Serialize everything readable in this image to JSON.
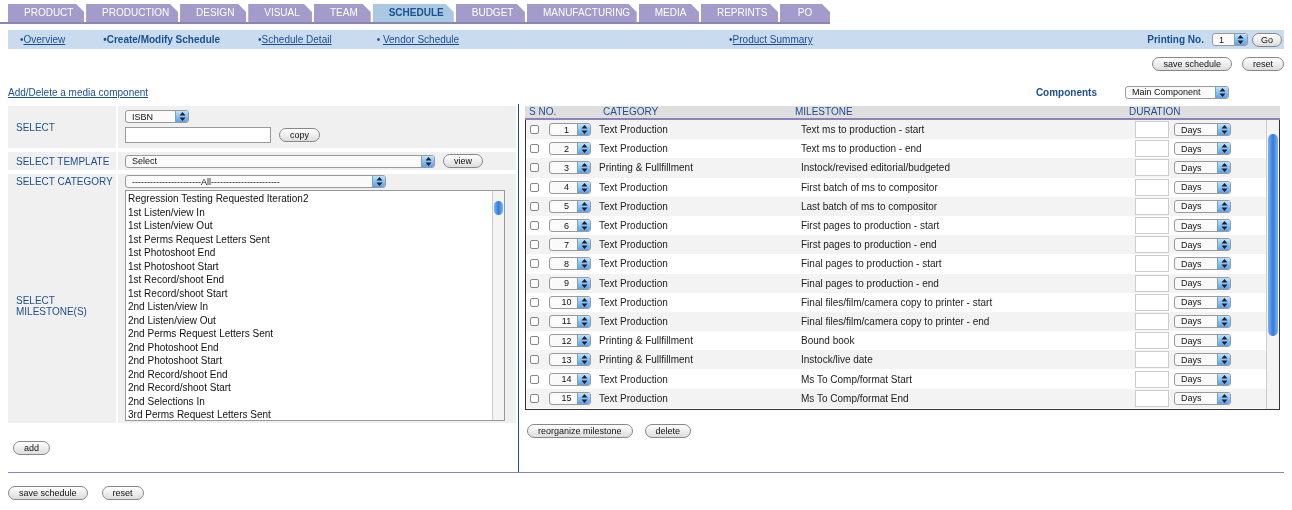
{
  "tabs": [
    {
      "label": "PRODUCT",
      "selected": false
    },
    {
      "label": "PRODUCTION",
      "selected": false
    },
    {
      "label": "DESIGN",
      "selected": false
    },
    {
      "label": "VISUAL",
      "selected": false
    },
    {
      "label": "TEAM",
      "selected": false
    },
    {
      "label": "SCHEDULE",
      "selected": true
    },
    {
      "label": "BUDGET",
      "selected": false
    },
    {
      "label": "MANUFACTURING",
      "selected": false
    },
    {
      "label": "MEDIA",
      "selected": false
    },
    {
      "label": "REPRINTS",
      "selected": false
    },
    {
      "label": "PO",
      "selected": false
    }
  ],
  "subnav": {
    "links": [
      {
        "bullet": "•",
        "label": "Overview",
        "selected": false
      },
      {
        "bullet": "•",
        "label": "Create/Modify Schedule",
        "selected": true
      },
      {
        "bullet": "•",
        "label": "Schedule Detail",
        "selected": false
      },
      {
        "bullet": "•  ",
        "label": "Vendor Schedule",
        "selected": false
      },
      {
        "bullet": "•",
        "label": "Product Summary",
        "selected": false
      }
    ],
    "printing": {
      "label": "Printing No.",
      "value": "1",
      "button": "Go"
    }
  },
  "top_buttons": [
    "save schedule",
    "reset"
  ],
  "media_link": "Add/Delete a media component",
  "components": {
    "label": "Components",
    "value": "Main Component"
  },
  "left": {
    "select": {
      "label": "SELECT",
      "value": "ISBN",
      "button": "copy"
    },
    "template": {
      "label": "SELECT TEMPLATE",
      "value": "Select",
      "button": "view"
    },
    "category": {
      "label": "SELECT CATEGORY",
      "value": "-----------------------All-----------------------"
    },
    "milestones": {
      "label": "SELECT MILESTONE(S)",
      "items": [
        "Regression Testing Requested Iteration2",
        "1st Listen/view In",
        "1st Listen/view Out",
        "1st Perms Request Letters Sent",
        "1st Photoshoot End",
        "1st Photoshoot Start",
        "1st Record/shoot End",
        "1st Record/shoot Start",
        "2nd Listen/view In",
        "2nd Listen/view Out",
        "2nd Perms Request Letters Sent",
        "2nd Photoshoot End",
        "2nd Photoshoot Start",
        "2nd Record/shoot End",
        "2nd Record/shoot Start",
        "2nd Selections In",
        "3rd Perms Request Letters Sent"
      ]
    },
    "add_button": "add"
  },
  "table": {
    "columns": [
      "S NO.",
      "CATEGORY",
      "MILESTONE",
      "DURATION"
    ],
    "rows": [
      {
        "checked": false,
        "sno": "1",
        "category": "Text Production",
        "milestone": "Text ms to production - start",
        "unit": "Days"
      },
      {
        "checked": false,
        "sno": "2",
        "category": "Text Production",
        "milestone": "Text ms to production - end",
        "unit": "Days"
      },
      {
        "checked": false,
        "sno": "3",
        "category": "Printing & Fullfillment",
        "milestone": "Instock/revised editorial/budgeted",
        "unit": "Days"
      },
      {
        "checked": false,
        "sno": "4",
        "category": "Text Production",
        "milestone": "First batch of ms to compositor",
        "unit": "Days"
      },
      {
        "checked": false,
        "sno": "5",
        "category": "Text Production",
        "milestone": "Last batch of ms to compositor",
        "unit": "Days"
      },
      {
        "checked": false,
        "sno": "6",
        "category": "Text Production",
        "milestone": "First pages to production - start",
        "unit": "Days"
      },
      {
        "checked": false,
        "sno": "7",
        "category": "Text Production",
        "milestone": "First pages to production - end",
        "unit": "Days"
      },
      {
        "checked": false,
        "sno": "8",
        "category": "Text Production",
        "milestone": "Final pages to production - start",
        "unit": "Days"
      },
      {
        "checked": false,
        "sno": "9",
        "category": "Text Production",
        "milestone": "Final pages to production - end",
        "unit": "Days"
      },
      {
        "checked": false,
        "sno": "10",
        "category": "Text Production",
        "milestone": "Final files/film/camera copy to printer - start",
        "unit": "Days"
      },
      {
        "checked": false,
        "sno": "11",
        "category": "Text Production",
        "milestone": "Final files/film/camera copy to printer - end",
        "unit": "Days"
      },
      {
        "checked": false,
        "sno": "12",
        "category": "Printing & Fullfillment",
        "milestone": "Bound book",
        "unit": "Days"
      },
      {
        "checked": false,
        "sno": "13",
        "category": "Printing & Fullfillment",
        "milestone": "Instock/live date",
        "unit": "Days"
      },
      {
        "checked": false,
        "sno": "14",
        "category": "Text Production",
        "milestone": "Ms To Comp/format Start",
        "unit": "Days"
      },
      {
        "checked": false,
        "sno": "15",
        "category": "Text Production",
        "milestone": "Ms To Comp/format End",
        "unit": "Days"
      }
    ],
    "buttons": [
      "reorganize milestone",
      "delete"
    ]
  },
  "bottom_buttons": [
    "save schedule",
    "reset"
  ]
}
